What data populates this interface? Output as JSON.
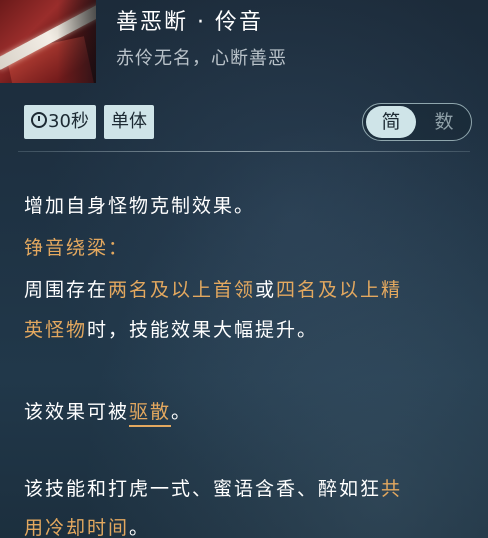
{
  "skill": {
    "name": "善恶断 · 伶音",
    "subtitle": "赤伶无名，心断善恶"
  },
  "tags": {
    "cooldown": "30秒",
    "target": "单体"
  },
  "toggle": {
    "simple_label": "简",
    "number_label": "数",
    "selected": "简"
  },
  "description": {
    "line1": "增加自身怪物克制效果。",
    "section_title": "铮音绕梁：",
    "line3_a": "周围存在",
    "line3_b": "两名及以上首领",
    "line3_c": "或",
    "line3_d": "四名及以上精",
    "line4_a": "英怪物",
    "line4_b": "时，技能效果大幅提升。",
    "line5_a": "该效果可被",
    "line5_b": "驱散",
    "line5_c": "。",
    "line6_a": "该技能和打虎一式、蜜语含香、醉如狂",
    "line6_b": "共",
    "line7_a": "用冷却时间",
    "line7_b": "。"
  },
  "colors": {
    "highlight": "#e3a85f",
    "tag_bg": "#cfe4e8",
    "text": "#ffffff",
    "subtitle": "#b9c2c9"
  }
}
